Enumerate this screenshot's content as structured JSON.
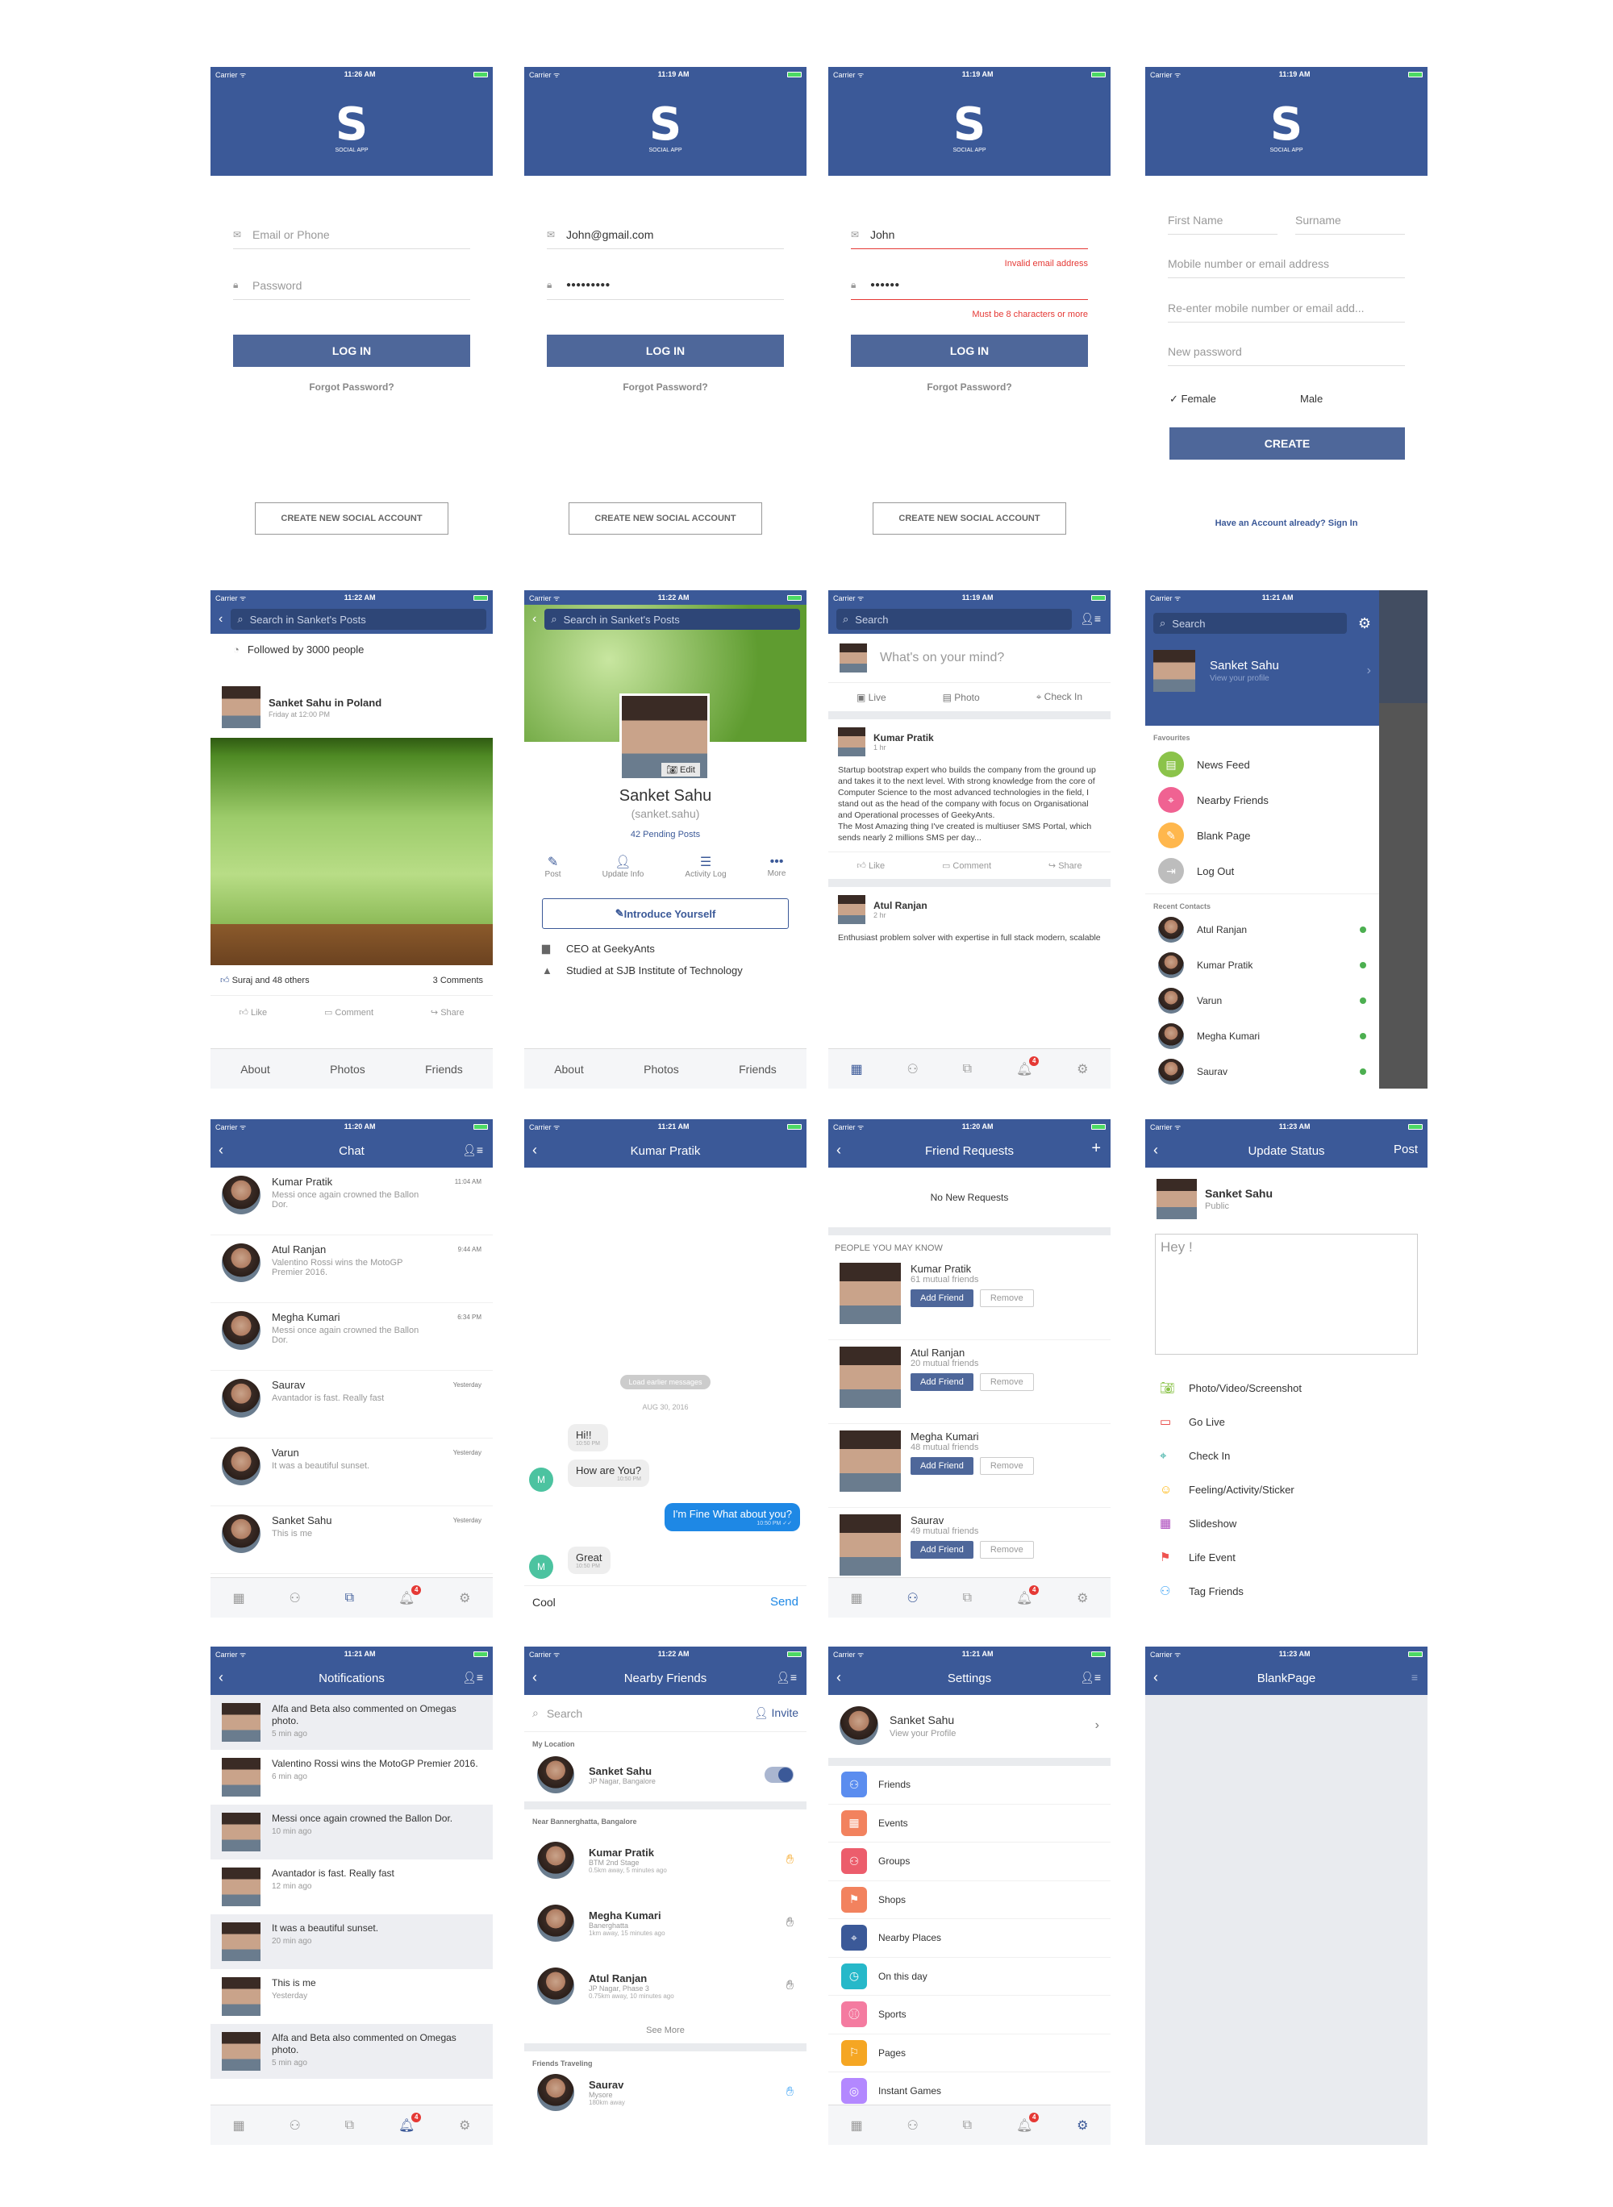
{
  "status": {
    "carrier": "Carrier ᯤ"
  },
  "login": {
    "brand": "SOCIAL APP",
    "email_ph": "Email or Phone",
    "password_ph": "Password",
    "login": "LOG IN",
    "forgot": "Forgot Password?",
    "create": "CREATE NEW SOCIAL ACCOUNT"
  },
  "times": [
    "11:26 AM",
    "11:19 AM",
    "11:19 AM",
    "11:19 AM",
    "11:22 AM",
    "11:22 AM",
    "11:19 AM",
    "11:21 AM",
    "11:20 AM",
    "11:21 AM",
    "11:20 AM",
    "11:23 AM",
    "11:21 AM",
    "11:22 AM",
    "11:21 AM",
    "11:23 AM"
  ],
  "login2": {
    "email": "John@gmail.com",
    "password": "●●●●●●●●●"
  },
  "login3": {
    "email": "John",
    "email_err": "Invalid email address",
    "password": "●●●●●●",
    "pw_err": "Must be 8 characters or more"
  },
  "signup": {
    "first": "First Name",
    "surname": "Surname",
    "mobile": "Mobile number or email address",
    "reenter": "Re-enter mobile number or email add...",
    "newpw": "New password",
    "female": "✓ Female",
    "male": "Male",
    "create": "CREATE",
    "signin": "Have an Account already? Sign In"
  },
  "posts": {
    "search": "Search in Sanket's Posts",
    "followed": "Followed by 3000 people",
    "author": "Sanket Sahu in Poland",
    "time": "Friday at 12:00 PM",
    "likes": "Suraj and 48 others",
    "comments": "3 Comments",
    "like": "Like",
    "comment": "Comment",
    "share": "Share",
    "tabs": [
      "About",
      "Photos",
      "Friends"
    ]
  },
  "profile": {
    "edit": "Edit",
    "name": "Sanket Sahu",
    "handle": "(sanket.sahu)",
    "pending": "42 Pending Posts",
    "actions": [
      "Post",
      "Update Info",
      "Activity Log",
      "More"
    ],
    "intro": "Introduce Yourself",
    "job": "CEO at GeekyAnts",
    "school": "Studied at SJB Institute of Technology"
  },
  "feed": {
    "search": "Search",
    "mind": "What's on your mind?",
    "live": "Live",
    "photo": "Photo",
    "checkin": "Check In",
    "p1_name": "Kumar Pratik",
    "p1_time": "1 hr",
    "p1_text": "Startup bootstrap expert who builds the company from the ground up and takes it to the next level. With strong knowledge from the core of Computer Science to the most advanced technologies in the field, I stand out as the head of the company with focus on Organisational and Operational processes of GeekyAnts.\nThe Most Amazing thing I've created is multiuser SMS Portal, which sends nearly 2 millions SMS per day...",
    "p2_name": "Atul Ranjan",
    "p2_time": "2 hr",
    "p2_text": "Enthusiast problem solver with expertise in full stack modern, scalable and efficient web development with",
    "badge": "4"
  },
  "menu": {
    "search": "Search",
    "name": "Sanket Sahu",
    "sub": "View your profile",
    "fav": "Favourites",
    "favs": [
      "News Feed",
      "Nearby Friends",
      "Blank Page",
      "Log Out"
    ],
    "recent": "Recent Contacts",
    "contacts": [
      "Atul Ranjan",
      "Kumar Pratik",
      "Varun",
      "Megha Kumari",
      "Saurav"
    ]
  },
  "chat": {
    "title": "Chat",
    "items": [
      {
        "n": "Kumar Pratik",
        "m": "Messi once again crowned the Ballon Dor.",
        "t": "11:04 AM"
      },
      {
        "n": "Atul Ranjan",
        "m": "Valentino Rossi wins the MotoGP Premier 2016.",
        "t": "9:44 AM"
      },
      {
        "n": "Megha Kumari",
        "m": "Messi once again crowned the Ballon Dor.",
        "t": "6:34 PM"
      },
      {
        "n": "Saurav",
        "m": "Avantador is fast. Really fast",
        "t": "Yesterday"
      },
      {
        "n": "Varun",
        "m": "It was a beautiful sunset.",
        "t": "Yesterday"
      },
      {
        "n": "Sanket Sahu",
        "m": "This is me",
        "t": "Yesterday"
      }
    ]
  },
  "convo": {
    "title": "Kumar Pratik",
    "load": "Load earlier messages",
    "date": "AUG 30, 2016",
    "m1": "Hi!!",
    "m1t": "10:50 PM",
    "m2": "How are You?",
    "m2t": "10:50 PM",
    "m3": "I'm Fine What about you?",
    "m3t": "10:50 PM ✓✓",
    "m4": "Great",
    "m4t": "10:50 PM",
    "input": "Cool",
    "send": "Send",
    "initial": "M"
  },
  "requests": {
    "title": "Friend Requests",
    "none": "No New Requests",
    "pymk": "PEOPLE YOU MAY KNOW",
    "add": "Add Friend",
    "remove": "Remove",
    "people": [
      {
        "n": "Kumar Pratik",
        "m": "61 mutual friends"
      },
      {
        "n": "Atul Ranjan",
        "m": "20 mutual friends"
      },
      {
        "n": "Megha Kumari",
        "m": "48 mutual friends"
      },
      {
        "n": "Saurav",
        "m": "49 mutual friends"
      }
    ]
  },
  "status_upd": {
    "title": "Update Status",
    "post": "Post",
    "name": "Sanket Sahu",
    "audience": "Public",
    "text": "Hey !",
    "options": [
      "Photo/Video/Screenshot",
      "Go Live",
      "Check In",
      "Feeling/Activity/Sticker",
      "Slideshow",
      "Life Event",
      "Tag Friends"
    ]
  },
  "notifs": {
    "title": "Notifications",
    "items": [
      {
        "t": "Alfa and Beta also commented on Omegas photo.",
        "a": "5 min ago"
      },
      {
        "t": "Valentino Rossi wins the MotoGP Premier 2016.",
        "a": "6 min ago"
      },
      {
        "t": "Messi once again crowned the Ballon Dor.",
        "a": "10 min ago"
      },
      {
        "t": "Avantador is fast. Really fast",
        "a": "12 min ago"
      },
      {
        "t": "It was a beautiful sunset.",
        "a": "20 min ago"
      },
      {
        "t": "This is me",
        "a": "Yesterday"
      },
      {
        "t": "Alfa and Beta also commented on Omegas photo.",
        "a": "5 min ago"
      }
    ]
  },
  "nearby": {
    "title": "Nearby Friends",
    "search": "Search",
    "invite": "Invite",
    "myloc": "My Location",
    "me": "Sanket Sahu",
    "me_loc": "JP Nagar, Bangalore",
    "near": "Near Bannerghatta, Bangalore",
    "people": [
      {
        "n": "Kumar Pratik",
        "l": "BTM 2nd Stage",
        "d": "0.5km away, 5 minutes ago"
      },
      {
        "n": "Megha Kumari",
        "l": "Banerghatta",
        "d": "1km away, 15 minutes ago"
      },
      {
        "n": "Atul Ranjan",
        "l": "JP Nagar, Phase 3",
        "d": "0.75km away, 10 minutes ago"
      }
    ],
    "seemore": "See More",
    "traveling": "Friends Traveling",
    "trav": {
      "n": "Saurav",
      "l": "Mysore",
      "d": "180km away"
    }
  },
  "settings": {
    "title": "Settings",
    "name": "Sanket Sahu",
    "sub": "View your Profile",
    "items": [
      "Friends",
      "Events",
      "Groups",
      "Shops",
      "Nearby Places",
      "On this day",
      "Sports",
      "Pages",
      "Instant Games"
    ],
    "colors": [
      "#5b8def",
      "#f2825e",
      "#ec5d6c",
      "#f2825e",
      "#3b5998",
      "#26b8c9",
      "#f47ba0",
      "#f5a623",
      "#b388ff"
    ]
  },
  "blank": {
    "title": "BlankPage"
  }
}
